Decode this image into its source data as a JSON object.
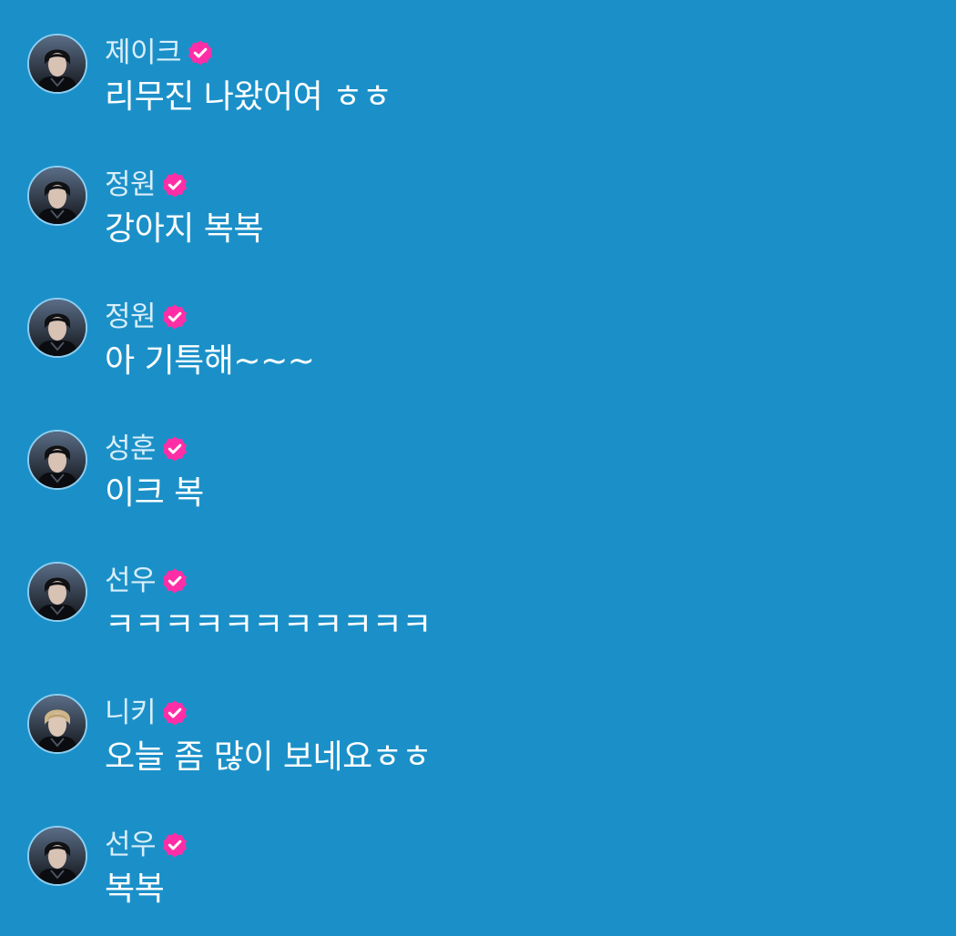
{
  "messages": [
    {
      "name": "제이크",
      "text": "리무진 나왔어여 ㅎㅎ",
      "avatar_icon": "jake-avatar",
      "verified": true
    },
    {
      "name": "정원",
      "text": "강아지 복복",
      "avatar_icon": "jungwon-avatar",
      "verified": true
    },
    {
      "name": "정원",
      "text": "아 기특해~~~",
      "avatar_icon": "jungwon-avatar",
      "verified": true
    },
    {
      "name": "성훈",
      "text": "이크 복",
      "avatar_icon": "sunghoon-avatar",
      "verified": true
    },
    {
      "name": "선우",
      "text": "ㅋㅋㅋㅋㅋㅋㅋㅋㅋㅋㅋ",
      "avatar_icon": "sunoo-avatar",
      "verified": true
    },
    {
      "name": "니키",
      "text": "오늘 좀 많이 보네요ㅎㅎ",
      "avatar_icon": "ni-ki-avatar",
      "verified": true
    },
    {
      "name": "선우",
      "text": "복복",
      "avatar_icon": "sunoo-avatar",
      "verified": true
    }
  ],
  "colors": {
    "background": "#1b90c8",
    "verified_badge": "#ff2ea6",
    "name_text": "#d9eefa",
    "message_text": "#ffffff"
  }
}
